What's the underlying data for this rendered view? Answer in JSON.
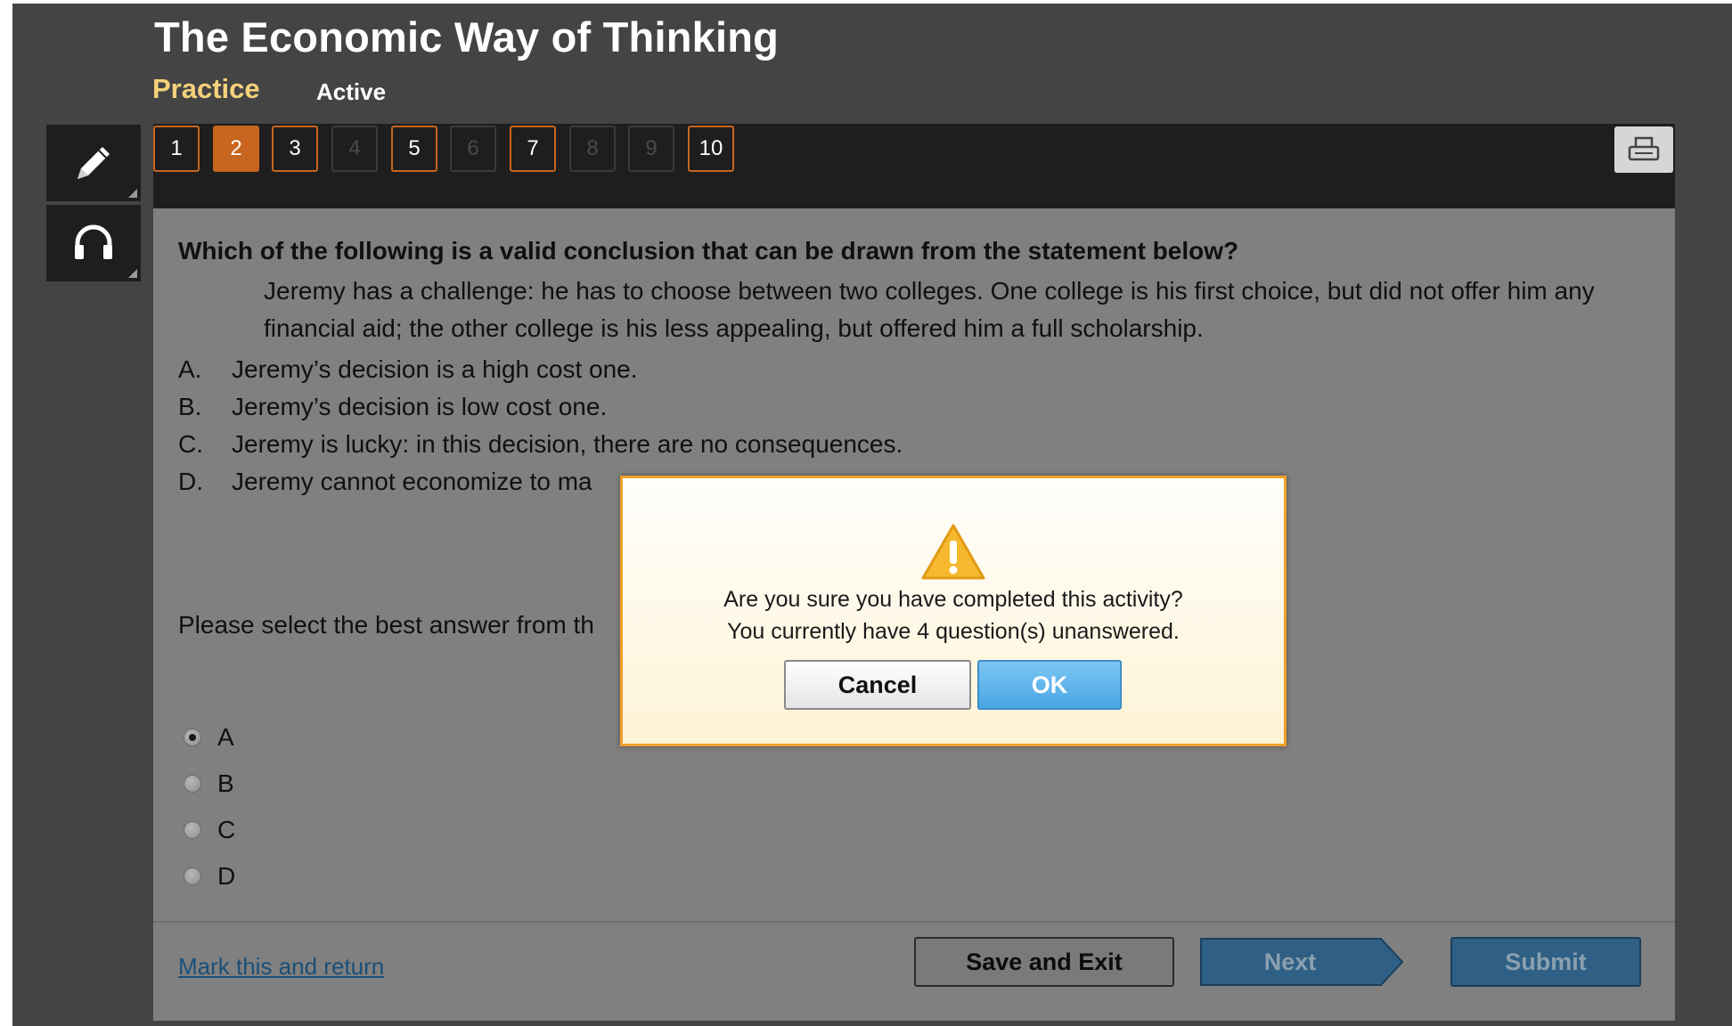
{
  "header": {
    "title": "The Economic Way of Thinking",
    "mode": "Practice",
    "status": "Active"
  },
  "colors": {
    "accent": "#c8651e",
    "mode_text": "#f5d27a",
    "dialog_border": "#f0a02a",
    "ok_button": "#4aa6e4",
    "link": "#1a4f78"
  },
  "tools": [
    {
      "name": "pencil-icon"
    },
    {
      "name": "headphones-icon"
    }
  ],
  "question_nav": [
    {
      "label": "1",
      "state": "visited"
    },
    {
      "label": "2",
      "state": "current"
    },
    {
      "label": "3",
      "state": "visited"
    },
    {
      "label": "4",
      "state": "disabled"
    },
    {
      "label": "5",
      "state": "visited"
    },
    {
      "label": "6",
      "state": "disabled"
    },
    {
      "label": "7",
      "state": "visited"
    },
    {
      "label": "8",
      "state": "disabled"
    },
    {
      "label": "9",
      "state": "disabled"
    },
    {
      "label": "10",
      "state": "visited"
    }
  ],
  "print_icon": "printer-icon",
  "question": {
    "prompt": "Which of the following is a valid conclusion that can be drawn from the statement below?",
    "passage": "Jeremy has a challenge: he has to choose between two colleges. One college is his first choice, but did not offer him any financial aid; the other college is his less appealing, but offered him a full scholarship.",
    "choices": [
      {
        "letter": "A.",
        "text": "Jeremy’s decision is a high cost one."
      },
      {
        "letter": "B.",
        "text": "Jeremy’s decision is low cost one."
      },
      {
        "letter": "C.",
        "text": "Jeremy is lucky: in this decision, there are no consequences."
      },
      {
        "letter": "D.",
        "text": "Jeremy cannot economize to ma"
      }
    ],
    "instruction": "Please select the best answer from th",
    "answers": [
      {
        "label": "A",
        "checked": true
      },
      {
        "label": "B",
        "checked": false
      },
      {
        "label": "C",
        "checked": false
      },
      {
        "label": "D",
        "checked": false
      }
    ]
  },
  "footer": {
    "mark_link": "Mark this and return",
    "save_exit": "Save and Exit",
    "next": "Next",
    "submit": "Submit"
  },
  "dialog": {
    "icon": "warning-icon",
    "line1": "Are you sure you have completed this activity?",
    "line2": "You currently have 4 question(s) unanswered.",
    "cancel": "Cancel",
    "ok": "OK"
  }
}
